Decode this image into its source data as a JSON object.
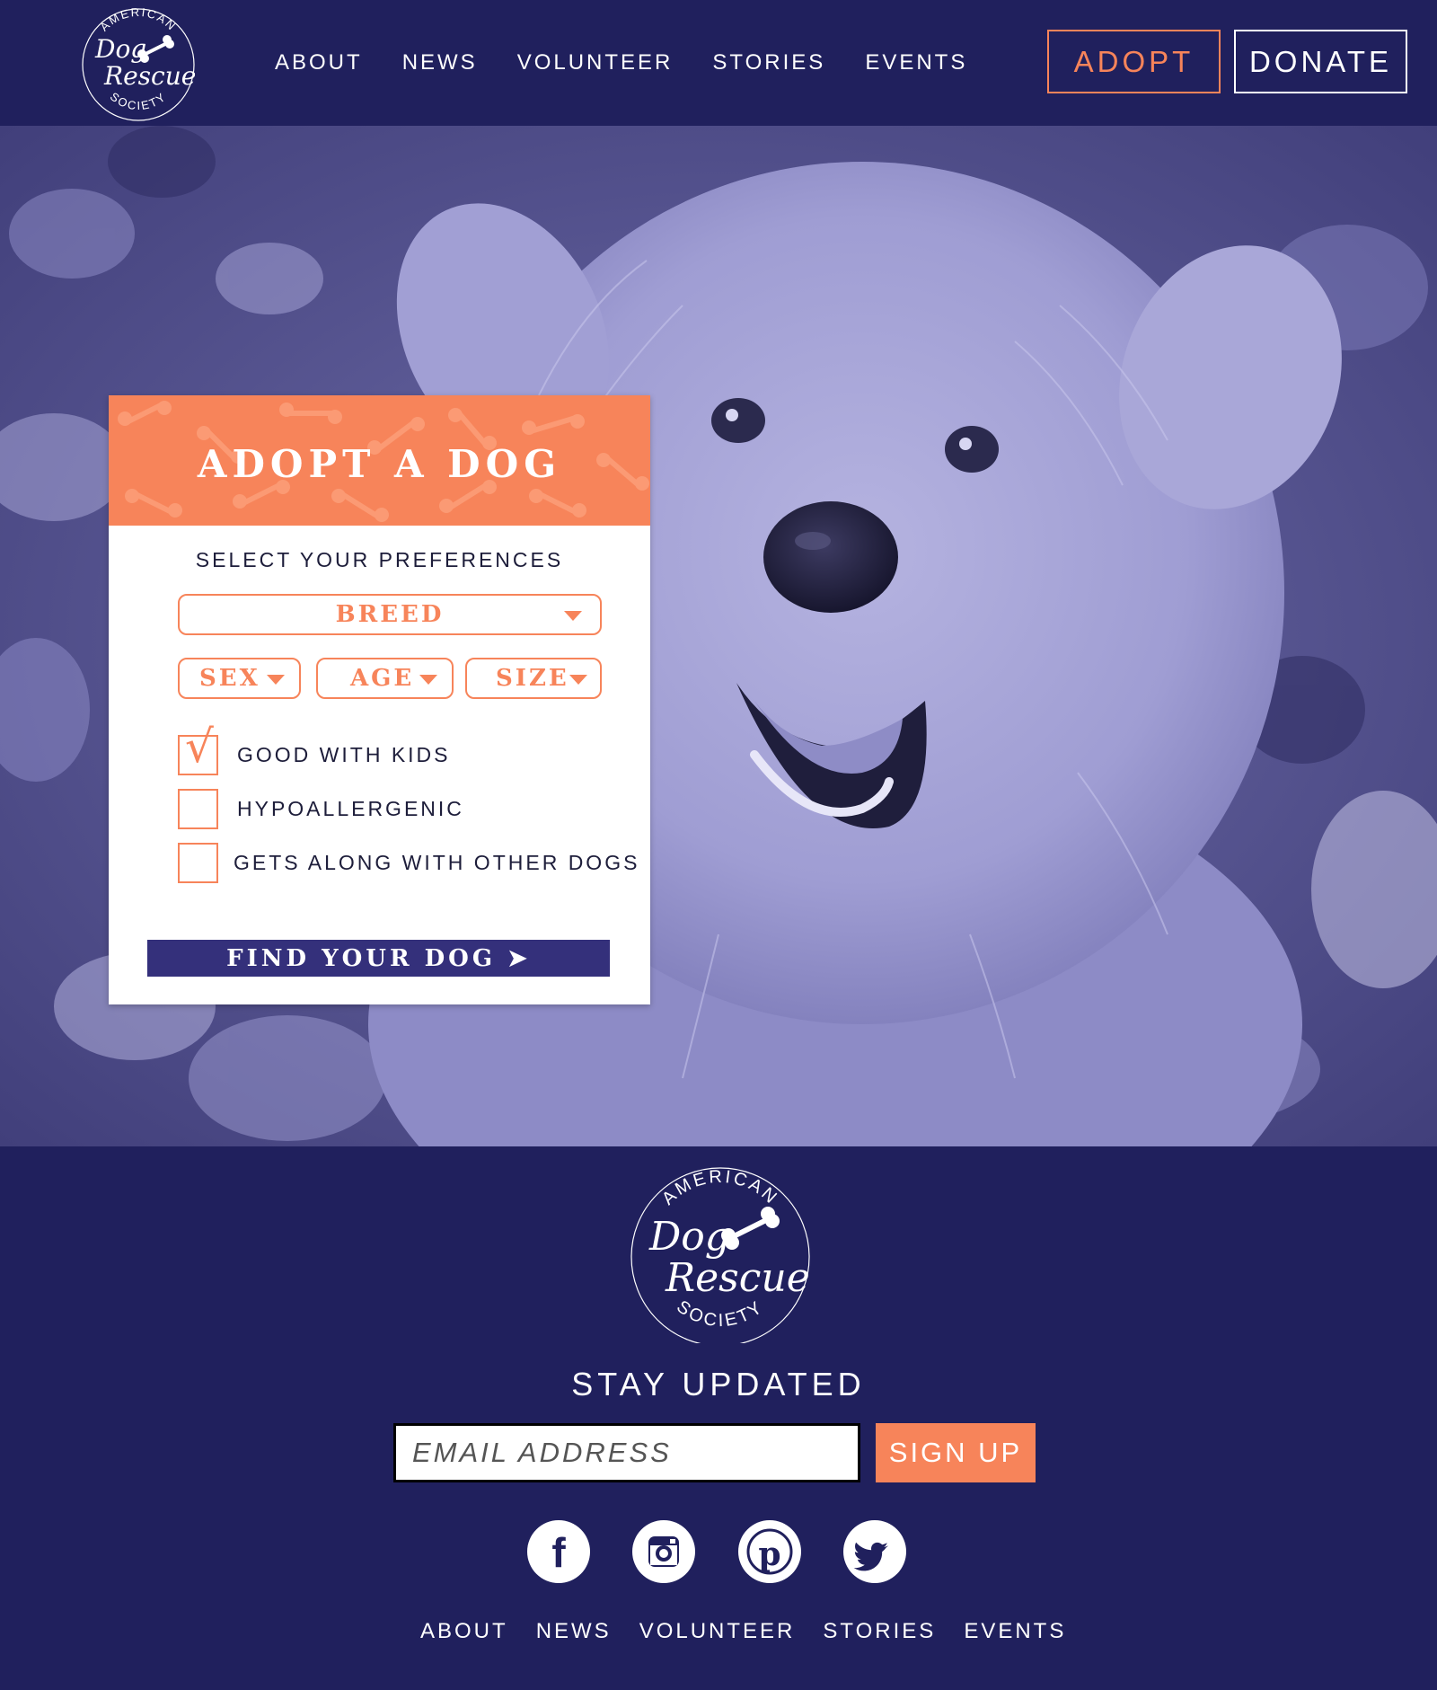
{
  "brand": {
    "logo_top": "AMERICAN",
    "logo_line1": "Dog",
    "logo_line2": "Rescue",
    "logo_bottom": "SOCIETY"
  },
  "header": {
    "nav": [
      "ABOUT",
      "NEWS",
      "VOLUNTEER",
      "STORIES",
      "EVENTS"
    ],
    "adopt_label": "ADOPT",
    "donate_label": "DONATE"
  },
  "adopt_panel": {
    "title": "ADOPT A DOG",
    "subtitle": "SELECT YOUR PREFERENCES",
    "selects": {
      "breed": "BREED",
      "sex": "SEX",
      "age": "AGE",
      "size": "SIZE"
    },
    "checkboxes": [
      {
        "label": "GOOD WITH KIDS",
        "checked": true
      },
      {
        "label": "HYPOALLERGENIC",
        "checked": false
      },
      {
        "label": "GETS ALONG WITH OTHER DOGS",
        "checked": false
      }
    ],
    "find_button": "FIND YOUR DOG ➤"
  },
  "footer": {
    "stay_updated": "STAY UPDATED",
    "email_placeholder": "EMAIL ADDRESS",
    "signup_label": "SIGN UP",
    "social": [
      "facebook-icon",
      "instagram-icon",
      "pinterest-icon",
      "twitter-icon"
    ],
    "nav": [
      "ABOUT",
      "NEWS",
      "VOLUNTEER",
      "STORIES",
      "EVENTS"
    ]
  },
  "colors": {
    "navy": "#20205d",
    "accent": "#f7845a",
    "button_purple": "#34307b",
    "hero_tint": "#8a88c6"
  }
}
